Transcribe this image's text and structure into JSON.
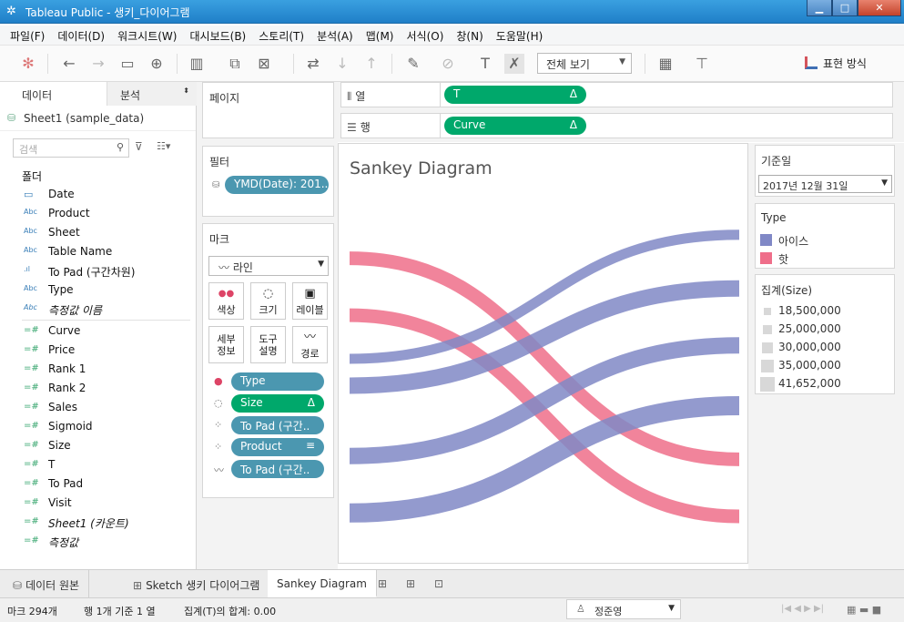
{
  "window": {
    "title": "Tableau Public - 생키_다이어그램"
  },
  "menu": [
    "파일(F)",
    "데이터(D)",
    "워크시트(W)",
    "대시보드(B)",
    "스토리(T)",
    "분석(A)",
    "맵(M)",
    "서식(O)",
    "창(N)",
    "도움말(H)"
  ],
  "toolbar": {
    "fit": "전체 보기",
    "show_me": "표현 방식"
  },
  "data_pane": {
    "tab_data": "데이터",
    "tab_analytics": "분석",
    "datasource": "Sheet1 (sample_data)",
    "search_placeholder": "검색",
    "folder_label": "폴더",
    "dimensions": [
      {
        "icon": "calendar",
        "name": "Date"
      },
      {
        "icon": "Abc",
        "name": "Product"
      },
      {
        "icon": "Abc",
        "name": "Sheet"
      },
      {
        "icon": "Abc",
        "name": "Table Name"
      },
      {
        "icon": "bin",
        "name": "To Pad (구간차원)"
      },
      {
        "icon": "Abc",
        "name": "Type"
      },
      {
        "icon": "Abc",
        "name": "측정값 이름",
        "italic": true
      }
    ],
    "measures": [
      {
        "name": "Curve"
      },
      {
        "name": "Price"
      },
      {
        "name": "Rank 1"
      },
      {
        "name": "Rank 2"
      },
      {
        "name": "Sales"
      },
      {
        "name": "Sigmoid"
      },
      {
        "name": "Size"
      },
      {
        "name": "T"
      },
      {
        "name": "To Pad"
      },
      {
        "name": "Visit"
      },
      {
        "name": "Sheet1 (카운트)",
        "italic": true
      },
      {
        "name": "측정값",
        "italic": true
      }
    ]
  },
  "pages": {
    "title": "페이지"
  },
  "filters": {
    "title": "필터",
    "items": [
      "YMD(Date): 201.."
    ]
  },
  "marks": {
    "title": "마크",
    "type": "라인",
    "buttons": [
      "색상",
      "크기",
      "레이블",
      "세부\n정보",
      "도구\n설명",
      "경로"
    ],
    "pills": [
      {
        "label": "Type",
        "color": "blue",
        "icon": "color"
      },
      {
        "label": "Size",
        "color": "green",
        "icon": "size",
        "delta": "Δ"
      },
      {
        "label": "To Pad (구간..",
        "color": "blue",
        "icon": "detail"
      },
      {
        "label": "Product",
        "color": "blue",
        "icon": "detail",
        "sort": "sort-icon"
      },
      {
        "label": "To Pad (구간..",
        "color": "blue",
        "icon": "path"
      }
    ]
  },
  "columns": {
    "label": "열",
    "pill": "T",
    "delta": "Δ"
  },
  "rows": {
    "label": "행",
    "pill": "Curve",
    "delta": "Δ"
  },
  "viz": {
    "title": "Sankey Diagram"
  },
  "chart_data": {
    "type": "sankey",
    "title": "Sankey Diagram",
    "colors": {
      "아이스": "#8088c6",
      "핫": "#ef6e8a"
    },
    "flows": [
      {
        "type": "핫",
        "size": 25000000,
        "left": 0.2,
        "right": 0.8
      },
      {
        "type": "핫",
        "size": 25000000,
        "left": 0.37,
        "right": 0.97
      },
      {
        "type": "아이스",
        "size": 18500000,
        "left": 0.5,
        "right": 0.13
      },
      {
        "type": "아이스",
        "size": 30000000,
        "left": 0.58,
        "right": 0.29
      },
      {
        "type": "아이스",
        "size": 30000000,
        "left": 0.79,
        "right": 0.46
      },
      {
        "type": "아이스",
        "size": 35000000,
        "left": 0.96,
        "right": 0.64
      }
    ]
  },
  "right_panel": {
    "date_title": "기준일",
    "date_value": "2017년 12월 31일",
    "type_title": "Type",
    "type_items": [
      {
        "label": "아이스",
        "color": "#8088c6"
      },
      {
        "label": "핫",
        "color": "#ef6e8a"
      }
    ],
    "size_title": "집계(Size)",
    "size_items": [
      "18,500,000",
      "25,000,000",
      "30,000,000",
      "35,000,000",
      "41,652,000"
    ]
  },
  "sheet_tabs": [
    "데이터 원본",
    "Sketch 생키 다이어그램",
    "Sankey Diagram"
  ],
  "status": {
    "marks": "마크 294개",
    "rowscols": "행 1개 기준 1 열",
    "sum": "집계(T)의 합계: 0.00",
    "user": "정준영"
  }
}
